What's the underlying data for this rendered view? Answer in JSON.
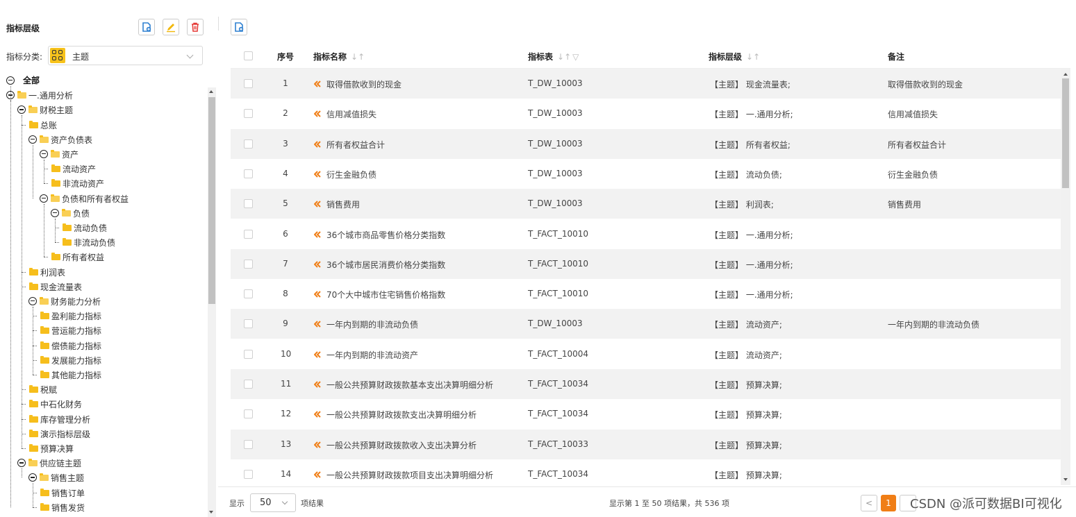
{
  "left_panel": {
    "title": "指标层级",
    "category_label": "指标分类:",
    "category_value": "主题",
    "tree": [
      {
        "label": "全部",
        "level": 0,
        "type": "root"
      },
      {
        "label": "一.通用分析",
        "level": 0,
        "type": "open"
      },
      {
        "label": "财税主题",
        "level": 1,
        "type": "open"
      },
      {
        "label": "总账",
        "level": 2,
        "type": "leaf"
      },
      {
        "label": "资产负债表",
        "level": 2,
        "type": "open"
      },
      {
        "label": "资产",
        "level": 3,
        "type": "open"
      },
      {
        "label": "流动资产",
        "level": 4,
        "type": "leaf"
      },
      {
        "label": "非流动资产",
        "level": 4,
        "type": "leaf"
      },
      {
        "label": "负债和所有者权益",
        "level": 3,
        "type": "open"
      },
      {
        "label": "负债",
        "level": 4,
        "type": "open"
      },
      {
        "label": "流动负债",
        "level": 5,
        "type": "leaf"
      },
      {
        "label": "非流动负债",
        "level": 5,
        "type": "leaf"
      },
      {
        "label": "所有者权益",
        "level": 4,
        "type": "leaf"
      },
      {
        "label": "利润表",
        "level": 2,
        "type": "leaf"
      },
      {
        "label": "现金流量表",
        "level": 2,
        "type": "leaf"
      },
      {
        "label": "财务能力分析",
        "level": 2,
        "type": "open"
      },
      {
        "label": "盈利能力指标",
        "level": 3,
        "type": "leaf"
      },
      {
        "label": "营运能力指标",
        "level": 3,
        "type": "leaf"
      },
      {
        "label": "偿债能力指标",
        "level": 3,
        "type": "leaf"
      },
      {
        "label": "发展能力指标",
        "level": 3,
        "type": "leaf"
      },
      {
        "label": "其他能力指标",
        "level": 3,
        "type": "leaf"
      },
      {
        "label": "税赋",
        "level": 2,
        "type": "leaf"
      },
      {
        "label": "中石化财务",
        "level": 2,
        "type": "leaf"
      },
      {
        "label": "库存管理分析",
        "level": 2,
        "type": "leaf"
      },
      {
        "label": "演示指标层级",
        "level": 2,
        "type": "leaf"
      },
      {
        "label": "预算决算",
        "level": 2,
        "type": "leaf"
      },
      {
        "label": "供应链主题",
        "level": 1,
        "type": "open"
      },
      {
        "label": "销售主题",
        "level": 2,
        "type": "open"
      },
      {
        "label": "销售订单",
        "level": 3,
        "type": "leaf"
      },
      {
        "label": "销售发货",
        "level": 3,
        "type": "leaf"
      }
    ]
  },
  "table": {
    "headers": {
      "seq": "序号",
      "name": "指标名称",
      "table": "指标表",
      "level": "指标层级",
      "note": "备注"
    },
    "rows": [
      {
        "seq": "1",
        "name": "取得借款收到的现金",
        "table": "T_DW_10003",
        "level": "【主题】 现金流量表;",
        "note": "取得借款收到的现金"
      },
      {
        "seq": "2",
        "name": "信用减值损失",
        "table": "T_DW_10003",
        "level": "【主题】 一.通用分析;",
        "note": "信用减值损失"
      },
      {
        "seq": "3",
        "name": "所有者权益合计",
        "table": "T_DW_10003",
        "level": "【主题】 所有者权益;",
        "note": "所有者权益合计"
      },
      {
        "seq": "4",
        "name": "衍生金融负债",
        "table": "T_DW_10003",
        "level": "【主题】 流动负债;",
        "note": "衍生金融负债"
      },
      {
        "seq": "5",
        "name": "销售费用",
        "table": "T_DW_10003",
        "level": "【主题】 利润表;",
        "note": "销售费用"
      },
      {
        "seq": "6",
        "name": "36个城市商品零售价格分类指数",
        "table": "T_FACT_10010",
        "level": "【主题】 一.通用分析;",
        "note": ""
      },
      {
        "seq": "7",
        "name": "36个城市居民消费价格分类指数",
        "table": "T_FACT_10010",
        "level": "【主题】 一.通用分析;",
        "note": ""
      },
      {
        "seq": "8",
        "name": "70个大中城市住宅销售价格指数",
        "table": "T_FACT_10010",
        "level": "【主题】 一.通用分析;",
        "note": ""
      },
      {
        "seq": "9",
        "name": "一年内到期的非流动负债",
        "table": "T_DW_10003",
        "level": "【主题】 流动资产;",
        "note": "一年内到期的非流动负债"
      },
      {
        "seq": "10",
        "name": "一年内到期的非流动资产",
        "table": "T_FACT_10004",
        "level": "【主题】 流动资产;",
        "note": ""
      },
      {
        "seq": "11",
        "name": "一般公共预算财政拨款基本支出决算明细分析",
        "table": "T_FACT_10034",
        "level": "【主题】 预算决算;",
        "note": ""
      },
      {
        "seq": "12",
        "name": "一般公共预算财政拨款支出决算明细分析",
        "table": "T_FACT_10034",
        "level": "【主题】 预算决算;",
        "note": ""
      },
      {
        "seq": "13",
        "name": "一般公共预算财政拨款收入支出决算分析",
        "table": "T_FACT_10033",
        "level": "【主题】 预算决算;",
        "note": ""
      },
      {
        "seq": "14",
        "name": "一般公共预算财政拨款项目支出决算明细分析",
        "table": "T_FACT_10034",
        "level": "【主题】 预算决算;",
        "note": ""
      }
    ]
  },
  "footer": {
    "show_label": "显示",
    "page_size": "50",
    "items_label": "项结果",
    "summary": "显示第 1 至 50 项结果，共 536 项",
    "prev": "<",
    "current_page": "1",
    "watermark": "CSDN @派可数据BI可视化"
  },
  "colors": {
    "accent": "#f07e16",
    "folder": "#f6be1c",
    "row_alt": "#f2f2f2",
    "category_icon_bg": "#f7c21b"
  },
  "icons": {
    "add": "add-file-icon",
    "edit": "pencil-icon",
    "delete": "trash-icon",
    "row": "indicator-link-icon"
  }
}
